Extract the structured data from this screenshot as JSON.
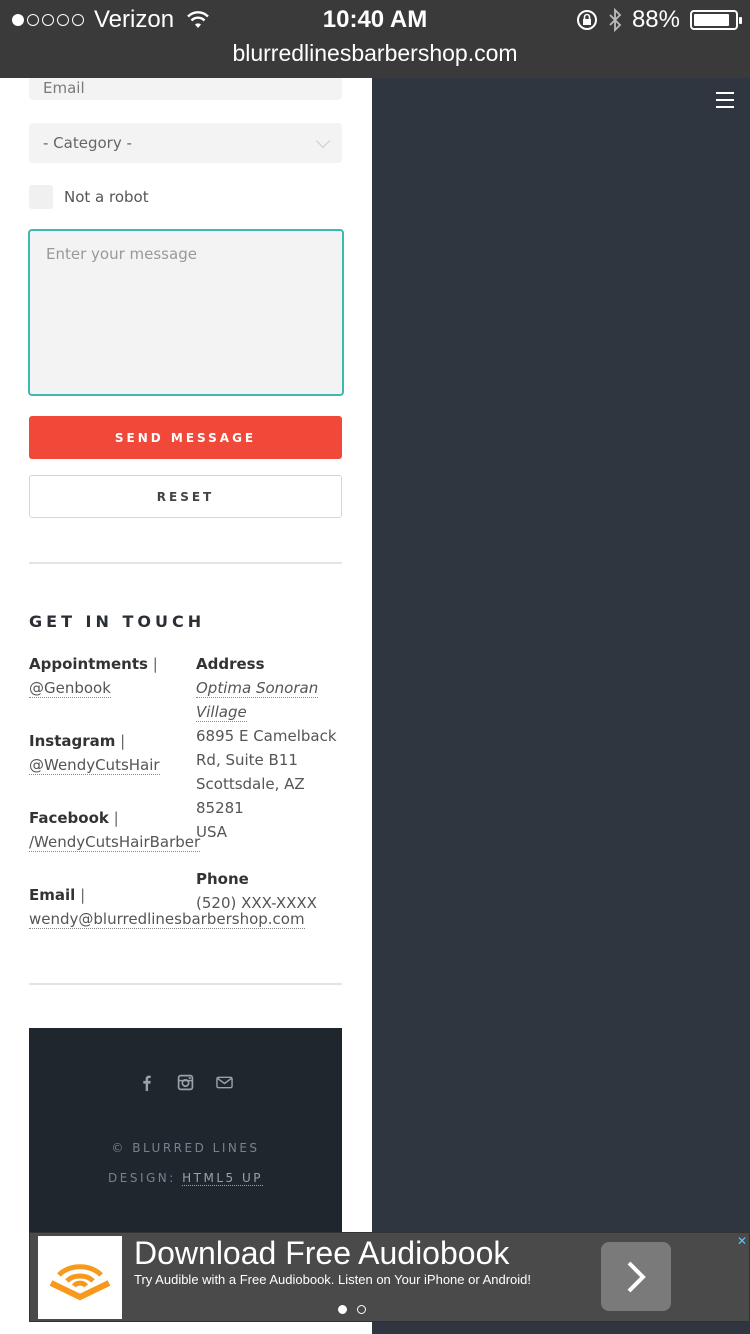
{
  "status_bar": {
    "carrier": "Verizon",
    "time": "10:40 AM",
    "battery": "88%",
    "battery_level": 0.88,
    "url": "blurredlinesbarbershop.com"
  },
  "form": {
    "email_placeholder": "Email",
    "category_value": "- Category -",
    "robot_label": "Not a robot",
    "message_placeholder": "Enter your message",
    "send_label": "SEND MESSAGE",
    "reset_label": "RESET"
  },
  "contact": {
    "title": "GET IN TOUCH",
    "appointments": {
      "label": "Appointments",
      "sep": "|",
      "link": "@Genbook"
    },
    "instagram": {
      "label": "Instagram",
      "sep": "|",
      "link": "@WendyCutsHair"
    },
    "facebook": {
      "label": "Facebook",
      "sep": "|",
      "link": "/WendyCutsHairBarber"
    },
    "email": {
      "label": "Email",
      "sep": "|",
      "link": "wendy@blurredlinesbarbershop.com"
    },
    "address": {
      "label": "Address",
      "link_line1": "Optima Sonoran",
      "link_line2": "Village",
      "line1": "6895 E Camelback",
      "line2": "Rd, Suite B11",
      "line3": "Scottsdale, AZ",
      "line4": "85281",
      "line5": "USA"
    },
    "phone": {
      "label": "Phone",
      "value": "(520) XXX-XXXX"
    }
  },
  "footer": {
    "copyright": "© BLURRED LINES",
    "design_prefix": "DESIGN:",
    "design_link": "HTML5 UP"
  },
  "ad": {
    "title": "Download Free Audiobook",
    "description": "Try Audible with a Free Audiobook. Listen on Your iPhone or Android!",
    "close": "✕"
  },
  "colors": {
    "accent": "#f0493a",
    "focus_border": "#3fb8ad",
    "side_panel": "#2f3640",
    "footer_bg": "#20262d"
  }
}
